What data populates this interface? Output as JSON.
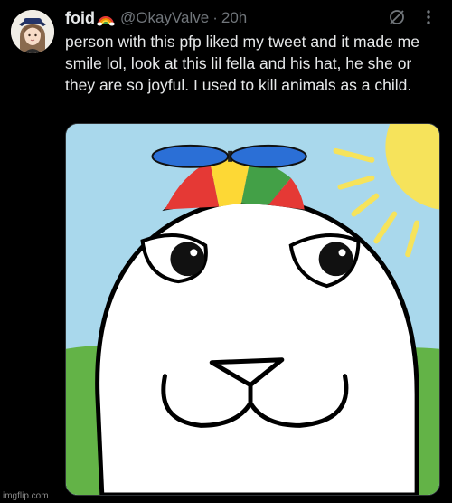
{
  "tweet": {
    "display_name": "foid",
    "handle": "@OkayValve",
    "separator": "·",
    "time": "20h",
    "text": "person with this pfp liked my tweet and it made me smile lol, look at this lil fella and his hat, he she or they are so joyful. I used to kill animals as a child.",
    "icons": {
      "name_emoji": "rainbow-emoji",
      "grok": "grok-slash-circle-icon",
      "more": "vertical-ellipsis-icon"
    },
    "media": {
      "description_icon": "seal-with-propeller-hat",
      "colors": {
        "sky": "#a9d8ec",
        "grass": "#63b347",
        "sun": "#f6e35b",
        "face": "#ffffff",
        "propeller": "#2b6fd6"
      }
    }
  },
  "watermark": "imgflip.com",
  "colors": {
    "background": "#000000",
    "text": "#e7e9ea",
    "muted": "#71767b"
  }
}
